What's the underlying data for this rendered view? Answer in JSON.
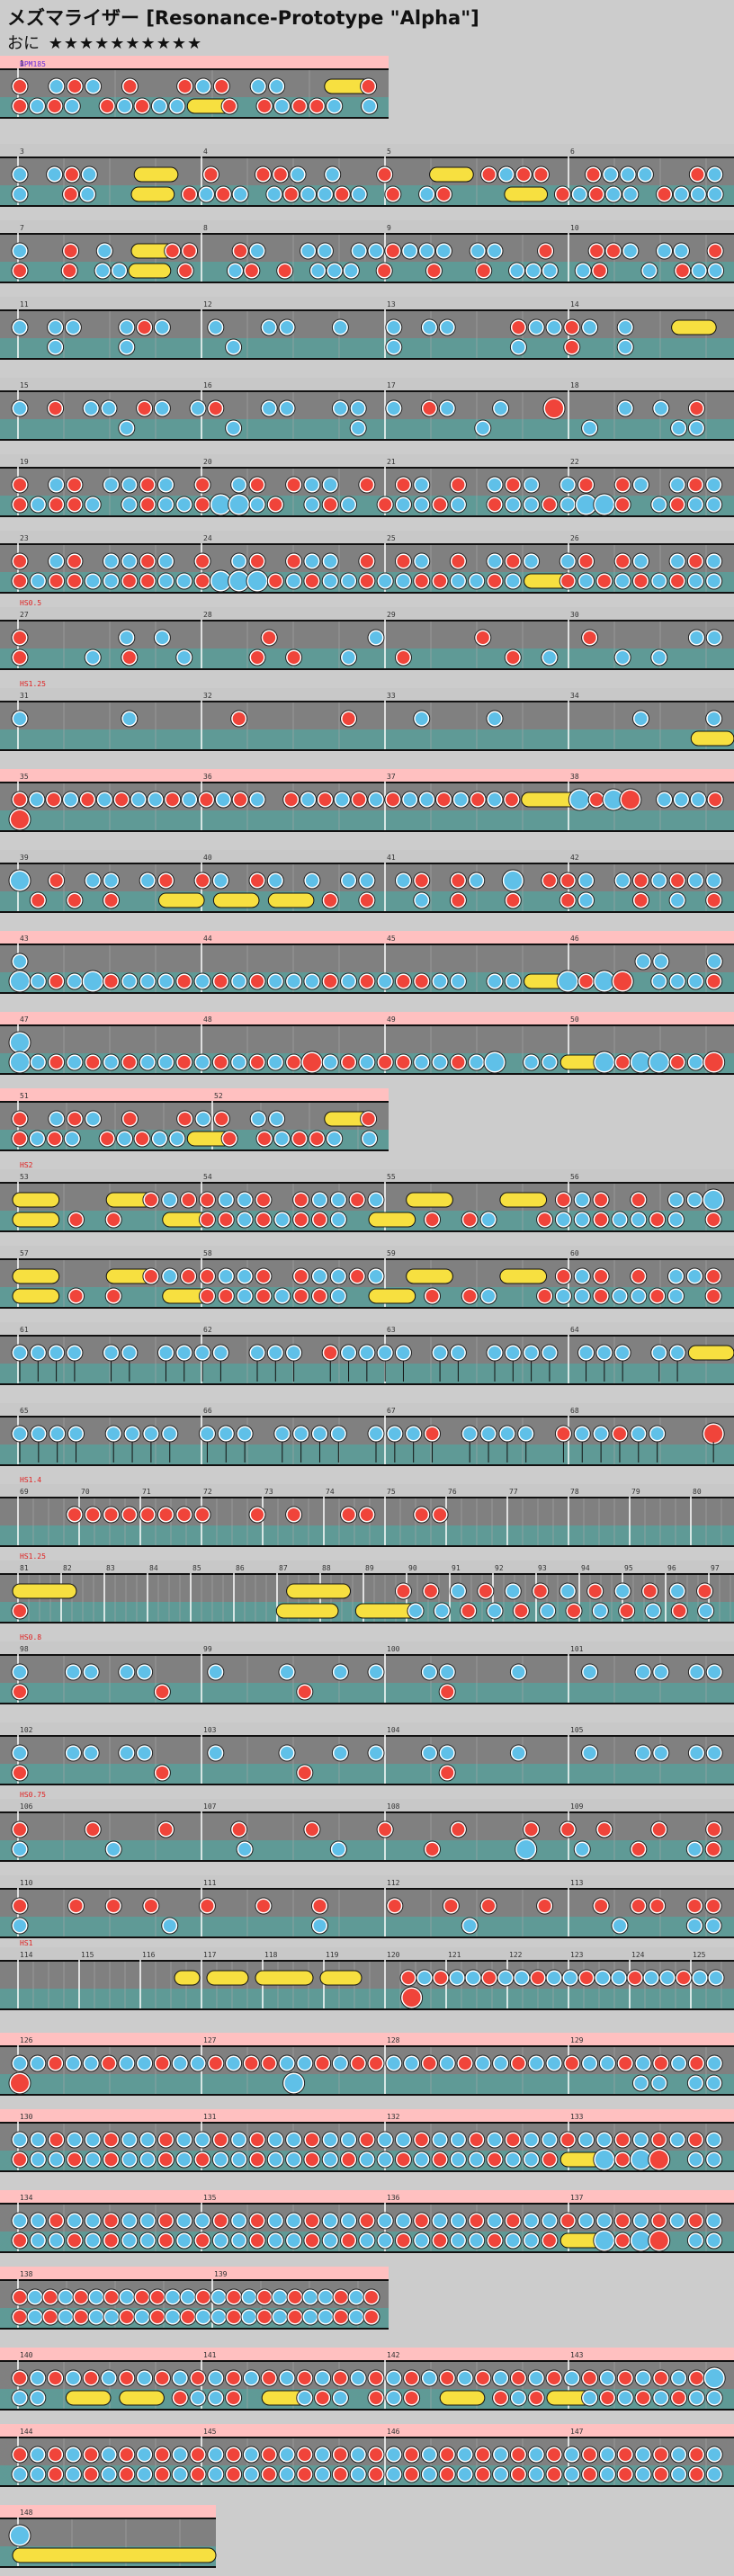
{
  "song": {
    "title_jp": "メズマライザー",
    "title_en": "[Resonance-Prototype \"Alpha\"]",
    "course_label": "おに",
    "stars": "★★★★★★★★★★"
  },
  "markers": {
    "bpm": "BPM185",
    "hs1": "HS0.5",
    "hs2": "HS1.25",
    "hs3": "HS1",
    "hs4": "HS1.4",
    "hs5": "HS1.25",
    "hs6": "HS0.8",
    "hs7": "HS0.75",
    "hs8": "HS2",
    "hs9": "HS1.25",
    "hs10": "HS1.25"
  },
  "chart_data": {
    "type": "taiko-chart",
    "notes": "Note layout encoded per row: d = don (red), k = ka (blue), D/K = big notes, = drumroll, . = rest",
    "rows": [
      {
        "bars": [
          "1"
        ],
        "pink": true,
        "short": true,
        "lines": [
          "d.kdk.d..dkd.kk..==d",
          "dkdk.dkdkk==d.dkddk.k"
        ]
      },
      {
        "bars": [
          "3",
          "4",
          "5",
          "6"
        ],
        "lines": [
          "k.kdk..==..d..ddk.k..d..==.dkdd..dkkk..dk",
          "k..dk..==.dkdk.kdkkdk.d.kd...==.dkdkk.dkkk"
        ]
      },
      {
        "bars": [
          "7",
          "8",
          "9",
          "10"
        ],
        "lines": [
          "k..d.k.==dd..dk..kk.kkdkkk.kk..d..ddk.kk.d",
          "d..d.kk==.d..kd.d.kkk.d..d..d.kkk.kd..k.dkk"
        ]
      },
      {
        "bars": [
          "11",
          "12",
          "13",
          "14"
        ],
        "lines": [
          "k.kk..kdk..k..kk..k..k.kk...dkkdk.k..==.",
          "..k...k.....k........k......k..d..k....."
        ]
      },
      {
        "bars": [
          "15",
          "16",
          "17",
          "18"
        ],
        "lines": [
          "k.d.kk.dk.kd..kk..kk.k.dk..k..D...k.k.d.",
          "......k.....k......k......k.....k....kk."
        ]
      },
      {
        "bars": [
          "19",
          "20",
          "21",
          "22"
        ],
        "lines": [
          "d.kd.kkdk.d.kd.dkk.d.dk.d.kdk.kd.dk.kdk",
          "dkddk.kdkkdKKkd.kdk.dkkdk.dkkdkKKd.kdkk"
        ]
      },
      {
        "bars": [
          "23",
          "24",
          "25",
          "26"
        ],
        "lines": [
          "d.kd.kkdk.d.kd.dkk.d.dk.d.kdk.kd.dk.kdk",
          "dkddkkddkkdKKKdkdkkdkkddkkdk==dkdkdkdkk"
        ]
      },
      {
        "bars": [
          "27",
          "28",
          "29",
          "30"
        ],
        "label": "hs1",
        "lines": [
          "d.....k.k.....d.....k.....d.....d.....kk",
          "d...k.d..k...d.d..k..d.....d.k...k.k..."
        ]
      },
      {
        "bars": [
          "31",
          "32",
          "33",
          "34"
        ],
        "label": "hs2",
        "lines": [
          "k.....k.....d.....d...k...k.......k...k",
          "........................................=="
        ]
      },
      {
        "bars": [
          "35",
          "36",
          "37",
          "38"
        ],
        "pink": true,
        "lines": [
          "dkdkdkdkkdkdkdk.dkdkdkdkkdkdkd===KdKD.kkkd",
          "D......................................."
        ]
      },
      {
        "bars": [
          "39",
          "40",
          "41",
          "42"
        ],
        "lines": [
          "K.d.kk.kd.dk.dk.k.kk.kd.dk.K.ddk.kdkdkk",
          ".d.d.d..==.==.==.d.d..k.d..d..dk..d.k.d"
        ]
      },
      {
        "bars": [
          "43",
          "44",
          "45",
          "46"
        ],
        "pink": true,
        "lines": [
          "k..................................kk..k",
          "KkdkKdkkkdkdkdkkkdkdkddkk.kk==KdKD.kkkd"
        ]
      },
      {
        "bars": [
          "47",
          "48",
          "49",
          "50"
        ],
        "pink": true,
        "lines": [
          "K.......................................",
          "KkdkdkdkkdkdkdkdDkdkddkkdkK.kk==KdKKdkD"
        ]
      },
      {
        "bars": [
          "51",
          "52"
        ],
        "pink": true,
        "short": true,
        "lines": [
          "d.kdk.d..dkd.kk..==d",
          "dkdk.dkdkk==d.dkddk.k"
        ]
      },
      {
        "bars": [
          "53",
          "54",
          "55",
          "56"
        ],
        "label": "hs8",
        "lines": [
          "==...==dkddkkd.dkkdk.==...==.dkd.d.kkK",
          "==.d.d..==ddkdkddk.==.d.dk..dkkdkkdk.d"
        ]
      },
      {
        "bars": [
          "57",
          "58",
          "59",
          "60"
        ],
        "lines": [
          "==...==dkddkkd.dkkdk.==...==.dkd.d.kkd",
          "==.d.d..==ddkdkddk.==.d.dk..dkkdkkdk.d"
        ]
      },
      {
        "bars": [
          "61",
          "62",
          "63",
          "64"
        ],
        "dense": true,
        "lines": [
          "kkkk.kk.kkkk.kkk.dkkkk.kk.kkkk.kkk.kk==",
          ""
        ]
      },
      {
        "bars": [
          "65",
          "66",
          "67",
          "68"
        ],
        "dense": true,
        "lines": [
          "kkkk.kkkk.kkk.kkkk.kkkd.kkkk.dkkdkk..D",
          ""
        ]
      },
      {
        "bars": [
          "69",
          "70",
          "71",
          "72",
          "73",
          "74",
          "75",
          "76",
          "77",
          "78",
          "79",
          "80"
        ],
        "label": "hs4",
        "lines": [
          "...dddddddd..d.d..dd..dd...............",
          ""
        ]
      },
      {
        "bars": [
          "81",
          "82",
          "83",
          "84",
          "85",
          "86",
          "87",
          "88",
          "89",
          "90",
          "91",
          "92",
          "93",
          "94",
          "95",
          "96",
          "97"
        ],
        "label": "hs5",
        "lines": [
          "==........==..ddkdkdkdkdkd",
          "d.........==.==kkdkdkdkdkdk"
        ]
      },
      {
        "bars": [
          "98",
          "99",
          "100",
          "101"
        ],
        "label": "hs6",
        "lines": [
          "k..kk.kk...k...k..k.k..kk...k...k..kk.kk",
          "d.......d.......d.......d..............."
        ]
      },
      {
        "bars": [
          "102",
          "103",
          "104",
          "105"
        ],
        "lines": [
          "k..kk.kk...k...k..k.k..kk...k...k..kk.kk",
          "d.......d.......d.......d..............."
        ]
      },
      {
        "bars": [
          "106",
          "107",
          "108",
          "109"
        ],
        "label": "hs7",
        "lines": [
          "d...d...d...d...d...d...d...d.d.d..d..d",
          "k....k......k....k....d....K..k..d..kd"
        ]
      },
      {
        "bars": [
          "110",
          "111",
          "112",
          "113"
        ],
        "lines": [
          "d..d.d.d..d..d..d...d..d.d..d..d.dd.dd",
          "k.......k.......k.......k.......k...kk"
        ]
      },
      {
        "bars": [
          "114",
          "115",
          "116",
          "117",
          "118",
          "119",
          "120",
          "121",
          "122",
          "123",
          "124",
          "125"
        ],
        "label": "hs3",
        "lines": [
          "..........=.==.===.==...dkdkkdkkdkkdkkdkkdkk",
          "......................D................."
        ]
      },
      {
        "bars": [
          "126",
          "127",
          "128",
          "129"
        ],
        "pink": true,
        "lines": [
          "kkdkkdkkdkkdkddkkdkddkkdkdkkdkkdkkdkdkdk",
          "D..............K..................kk.kk"
        ]
      },
      {
        "bars": [
          "130",
          "131",
          "132",
          "133"
        ],
        "pink": true,
        "lines": [
          "kkdkkdkkdkkdkdkkdkkdkkdkkdkdkkdkkdkdkdk",
          "dkkdkdkkdkdkkdkkdkdkkdkdkkdkkd==KdKD.kk"
        ]
      },
      {
        "bars": [
          "134",
          "135",
          "136",
          "137"
        ],
        "pink": true,
        "lines": [
          "kkdkkdkkdkkdkdkkdkkdkkdkkdkdkkdkkdkdkdk",
          "dkkdkdkkdkdkkdkkdkdkkdkdkkdkkd==KdKD.kk"
        ]
      },
      {
        "bars": [
          "138",
          "139"
        ],
        "pink": true,
        "short": true,
        "lines": [
          "dkdkdkdkddkkdkdkdkdkkdkd",
          "dkdkdkkdkdkdkkdkdkdkkdkd"
        ]
      },
      {
        "bars": [
          "140",
          "141",
          "142",
          "143"
        ],
        "pink": true,
        "lines": [
          "dkdkdkdkdkdkdkdkdkdkdkdkdkdkdkdkdkdkdkdK",
          "kk.==.==.dkkd.==kdk.dkd.==.dkd==kdkdkdkk"
        ]
      },
      {
        "bars": [
          "144",
          "145",
          "146",
          "147"
        ],
        "pink": true,
        "lines": [
          "dkdkdkdkdkdkdkdkdkdkdkdkdkdkdkdkdkdkdkdk",
          "kkdkdkdkdkdkdkdkdkdkdkdkdkdkdkdkdkdkdkdk"
        ]
      },
      {
        "bars": [
          "148"
        ],
        "pink": true,
        "tiny": true,
        "lines": [
          "K.",
          "=="
        ]
      }
    ]
  }
}
